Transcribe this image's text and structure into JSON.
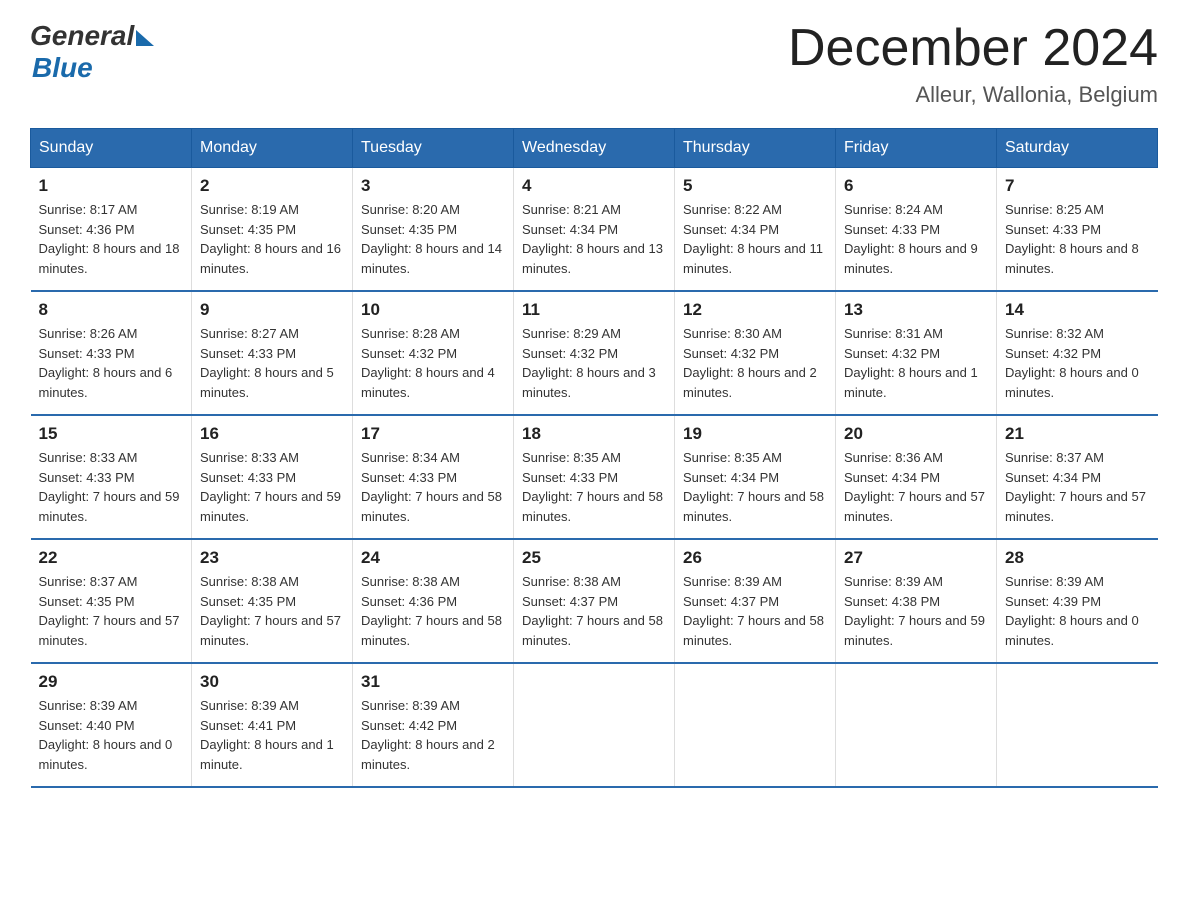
{
  "logo": {
    "general": "General",
    "blue": "Blue"
  },
  "title": "December 2024",
  "location": "Alleur, Wallonia, Belgium",
  "weekdays": [
    "Sunday",
    "Monday",
    "Tuesday",
    "Wednesday",
    "Thursday",
    "Friday",
    "Saturday"
  ],
  "weeks": [
    [
      {
        "day": "1",
        "sunrise": "8:17 AM",
        "sunset": "4:36 PM",
        "daylight": "8 hours and 18 minutes."
      },
      {
        "day": "2",
        "sunrise": "8:19 AM",
        "sunset": "4:35 PM",
        "daylight": "8 hours and 16 minutes."
      },
      {
        "day": "3",
        "sunrise": "8:20 AM",
        "sunset": "4:35 PM",
        "daylight": "8 hours and 14 minutes."
      },
      {
        "day": "4",
        "sunrise": "8:21 AM",
        "sunset": "4:34 PM",
        "daylight": "8 hours and 13 minutes."
      },
      {
        "day": "5",
        "sunrise": "8:22 AM",
        "sunset": "4:34 PM",
        "daylight": "8 hours and 11 minutes."
      },
      {
        "day": "6",
        "sunrise": "8:24 AM",
        "sunset": "4:33 PM",
        "daylight": "8 hours and 9 minutes."
      },
      {
        "day": "7",
        "sunrise": "8:25 AM",
        "sunset": "4:33 PM",
        "daylight": "8 hours and 8 minutes."
      }
    ],
    [
      {
        "day": "8",
        "sunrise": "8:26 AM",
        "sunset": "4:33 PM",
        "daylight": "8 hours and 6 minutes."
      },
      {
        "day": "9",
        "sunrise": "8:27 AM",
        "sunset": "4:33 PM",
        "daylight": "8 hours and 5 minutes."
      },
      {
        "day": "10",
        "sunrise": "8:28 AM",
        "sunset": "4:32 PM",
        "daylight": "8 hours and 4 minutes."
      },
      {
        "day": "11",
        "sunrise": "8:29 AM",
        "sunset": "4:32 PM",
        "daylight": "8 hours and 3 minutes."
      },
      {
        "day": "12",
        "sunrise": "8:30 AM",
        "sunset": "4:32 PM",
        "daylight": "8 hours and 2 minutes."
      },
      {
        "day": "13",
        "sunrise": "8:31 AM",
        "sunset": "4:32 PM",
        "daylight": "8 hours and 1 minute."
      },
      {
        "day": "14",
        "sunrise": "8:32 AM",
        "sunset": "4:32 PM",
        "daylight": "8 hours and 0 minutes."
      }
    ],
    [
      {
        "day": "15",
        "sunrise": "8:33 AM",
        "sunset": "4:33 PM",
        "daylight": "7 hours and 59 minutes."
      },
      {
        "day": "16",
        "sunrise": "8:33 AM",
        "sunset": "4:33 PM",
        "daylight": "7 hours and 59 minutes."
      },
      {
        "day": "17",
        "sunrise": "8:34 AM",
        "sunset": "4:33 PM",
        "daylight": "7 hours and 58 minutes."
      },
      {
        "day": "18",
        "sunrise": "8:35 AM",
        "sunset": "4:33 PM",
        "daylight": "7 hours and 58 minutes."
      },
      {
        "day": "19",
        "sunrise": "8:35 AM",
        "sunset": "4:34 PM",
        "daylight": "7 hours and 58 minutes."
      },
      {
        "day": "20",
        "sunrise": "8:36 AM",
        "sunset": "4:34 PM",
        "daylight": "7 hours and 57 minutes."
      },
      {
        "day": "21",
        "sunrise": "8:37 AM",
        "sunset": "4:34 PM",
        "daylight": "7 hours and 57 minutes."
      }
    ],
    [
      {
        "day": "22",
        "sunrise": "8:37 AM",
        "sunset": "4:35 PM",
        "daylight": "7 hours and 57 minutes."
      },
      {
        "day": "23",
        "sunrise": "8:38 AM",
        "sunset": "4:35 PM",
        "daylight": "7 hours and 57 minutes."
      },
      {
        "day": "24",
        "sunrise": "8:38 AM",
        "sunset": "4:36 PM",
        "daylight": "7 hours and 58 minutes."
      },
      {
        "day": "25",
        "sunrise": "8:38 AM",
        "sunset": "4:37 PM",
        "daylight": "7 hours and 58 minutes."
      },
      {
        "day": "26",
        "sunrise": "8:39 AM",
        "sunset": "4:37 PM",
        "daylight": "7 hours and 58 minutes."
      },
      {
        "day": "27",
        "sunrise": "8:39 AM",
        "sunset": "4:38 PM",
        "daylight": "7 hours and 59 minutes."
      },
      {
        "day": "28",
        "sunrise": "8:39 AM",
        "sunset": "4:39 PM",
        "daylight": "8 hours and 0 minutes."
      }
    ],
    [
      {
        "day": "29",
        "sunrise": "8:39 AM",
        "sunset": "4:40 PM",
        "daylight": "8 hours and 0 minutes."
      },
      {
        "day": "30",
        "sunrise": "8:39 AM",
        "sunset": "4:41 PM",
        "daylight": "8 hours and 1 minute."
      },
      {
        "day": "31",
        "sunrise": "8:39 AM",
        "sunset": "4:42 PM",
        "daylight": "8 hours and 2 minutes."
      },
      null,
      null,
      null,
      null
    ]
  ]
}
